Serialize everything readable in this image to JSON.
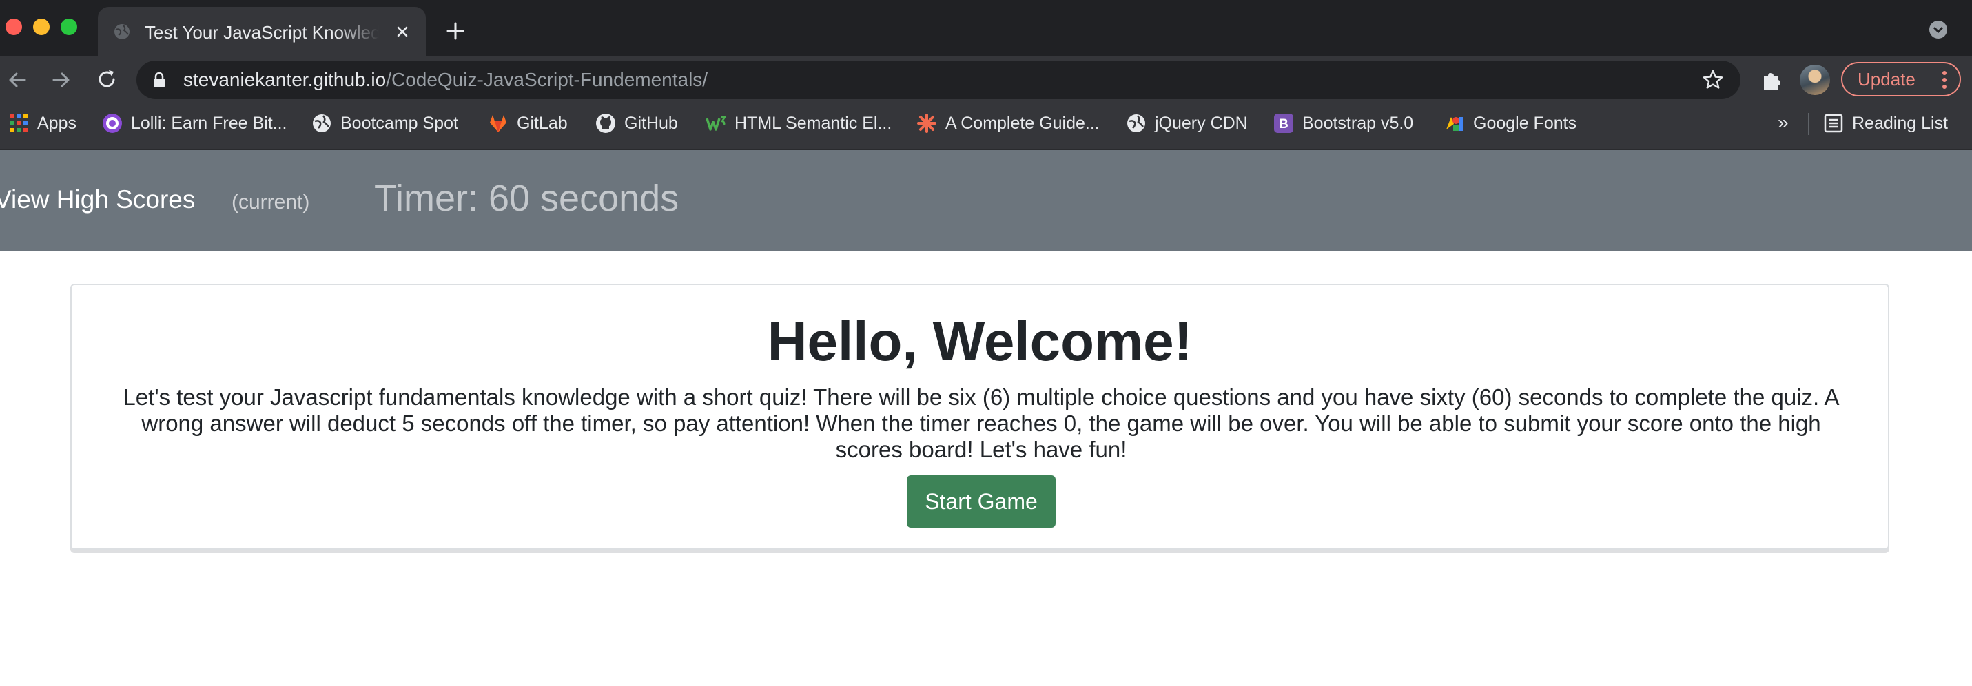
{
  "browser": {
    "tab": {
      "title": "Test Your JavaScript Knowledge"
    },
    "address_bar": {
      "host": "stevaniekanter.github.io",
      "path": "/CodeQuiz-JavaScript-Fundementals/"
    },
    "update_button": "Update",
    "bookmarks": [
      {
        "label": "Apps",
        "icon": "apps-grid-icon"
      },
      {
        "label": "Lolli: Earn Free Bit...",
        "icon": "lolli-icon"
      },
      {
        "label": "Bootcamp Spot",
        "icon": "globe-icon"
      },
      {
        "label": "GitLab",
        "icon": "gitlab-icon"
      },
      {
        "label": "GitHub",
        "icon": "github-icon"
      },
      {
        "label": "HTML Semantic El...",
        "icon": "w3-icon"
      },
      {
        "label": "A Complete Guide...",
        "icon": "css-tricks-icon"
      },
      {
        "label": "jQuery CDN",
        "icon": "globe-icon"
      },
      {
        "label": "Bootstrap v5.0",
        "icon": "bootstrap-icon"
      },
      {
        "label": "Google Fonts",
        "icon": "google-fonts-icon"
      }
    ],
    "more_bookmarks": "»",
    "reading_list": "Reading List"
  },
  "page": {
    "nav": {
      "high_scores": "View High Scores",
      "current": "(current)",
      "timer": "Timer: 60 seconds"
    },
    "welcome": {
      "heading": "Hello, Welcome!",
      "intro": "Let's test your Javascript fundamentals knowledge with a short quiz! There will be six (6) multiple choice questions and you have sixty (60) seconds to complete the quiz. A wrong answer will deduct 5 seconds off the timer, so pay attention! When the timer reaches 0, the game will be over. You will be able to submit your score onto the high scores board! Let's have fun!",
      "start_button": "Start Game"
    }
  },
  "colors": {
    "navbar": "#6c757d",
    "start_button": "#3d8357",
    "update_accent": "#f28b82"
  }
}
